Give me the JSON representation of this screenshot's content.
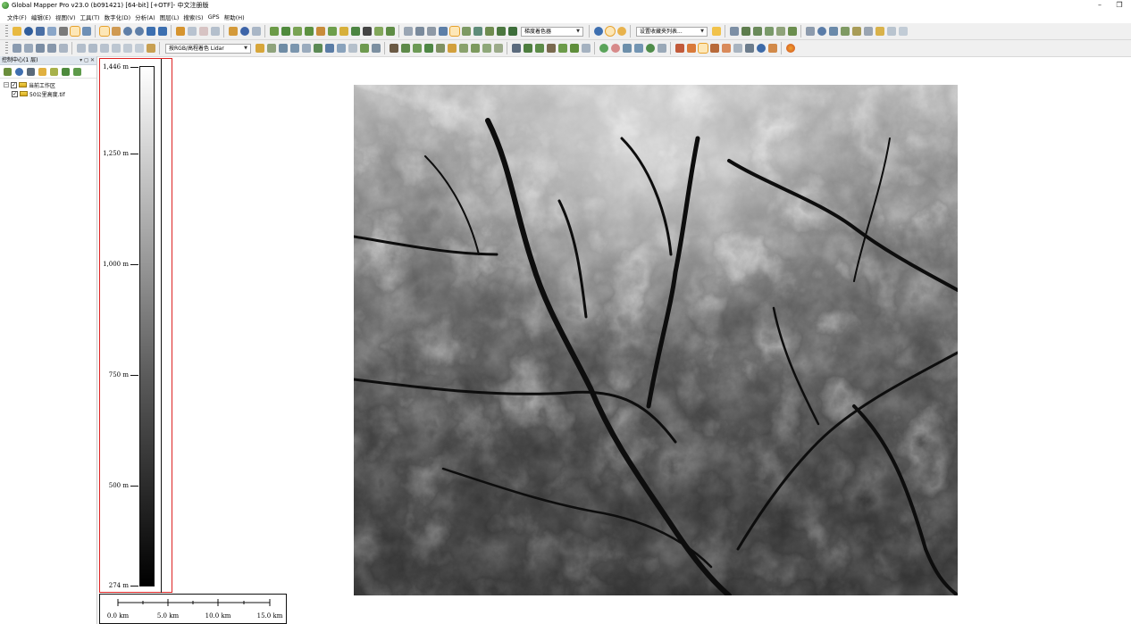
{
  "window": {
    "title": "Global Mapper Pro v23.0 (b091421) [64-bit] [+OTF]- 中文注册版",
    "minimize_glyph": "–",
    "restore_glyph": "❐"
  },
  "menu": [
    "文件(F)",
    "编辑(E)",
    "视图(V)",
    "工具(T)",
    "数字化(D)",
    "分析(A)",
    "图层(L)",
    "搜索(S)",
    "GPS",
    "帮助(H)"
  ],
  "toolbar": {
    "shader_combo": "梯度着色器",
    "favorites_combo": "设置收藏夹列表...",
    "lidar_combo": "按RGB/高程着色 Lidar"
  },
  "control_center": {
    "title": "控制中心(1 层)",
    "header_buttons": "▾ ◻ ✕",
    "tree": [
      {
        "label": "当前工作区",
        "level": 0
      },
      {
        "label": "50公里高度.tif",
        "level": 1
      }
    ]
  },
  "legend": {
    "min": 274,
    "max": 1446,
    "labels": [
      "1,446 m",
      "1,250 m",
      "1,000 m",
      "750 m",
      "500 m",
      "274 m"
    ],
    "values": [
      1446,
      1250,
      1000,
      750,
      500,
      274
    ],
    "colors": {
      "high": "#ffffff",
      "mid": "#5a5a5a",
      "low": "#000000"
    }
  },
  "scalebar": {
    "labels": [
      "0.0 km",
      "5.0 km",
      "10.0 km",
      "15.0 km"
    ]
  },
  "colors": {
    "legend_frame": "#dd2222",
    "active_tool": "#e7a12b"
  }
}
